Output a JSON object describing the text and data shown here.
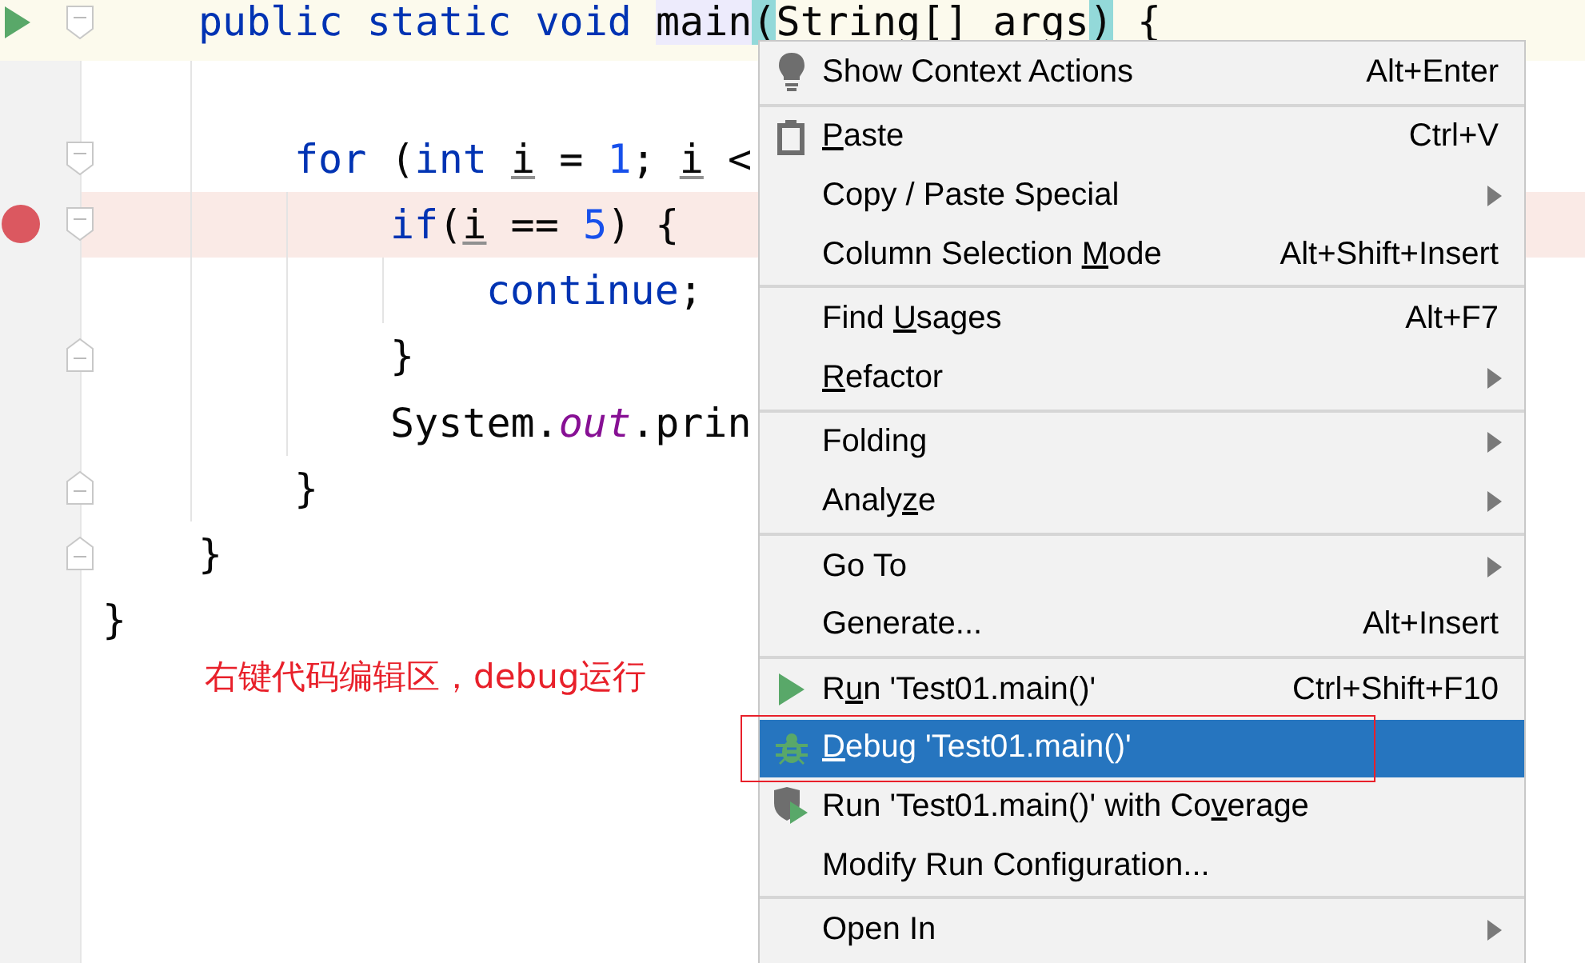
{
  "editor": {
    "lines": [
      {
        "children": [
          {
            "tokens": [
              {
                "text": "public static void ",
                "kind": "keyword"
              },
              {
                "text": "main",
                "kind": "plain",
                "usage_highlight": true
              },
              {
                "text": "(",
                "kind": "plain",
                "brace_match": true
              },
              {
                "text": "String[] args",
                "kind": "plain"
              },
              {
                "text": ")",
                "kind": "plain",
                "brace_match": true
              },
              {
                "text": " {",
                "kind": "plain"
              }
            ],
            "run_marker": true,
            "fold_start": true,
            "caret_line": true,
            "children": [
              {
                "kind": "blank"
              },
              {
                "tokens": [
                  {
                    "text": "for",
                    "kind": "keyword"
                  },
                  {
                    "text": " (",
                    "kind": "plain"
                  },
                  {
                    "text": "int ",
                    "kind": "keyword"
                  },
                  {
                    "text": "i",
                    "kind": "local"
                  },
                  {
                    "text": " = ",
                    "kind": "plain"
                  },
                  {
                    "text": "1",
                    "kind": "number"
                  },
                  {
                    "text": "; ",
                    "kind": "plain"
                  },
                  {
                    "text": "i",
                    "kind": "local"
                  },
                  {
                    "text": " <",
                    "kind": "plain"
                  }
                ],
                "fold_start": true,
                "children": [
                  {
                    "tokens": [
                      {
                        "text": "if",
                        "kind": "keyword"
                      },
                      {
                        "text": "(",
                        "kind": "plain"
                      },
                      {
                        "text": "i",
                        "kind": "local"
                      },
                      {
                        "text": " == ",
                        "kind": "plain"
                      },
                      {
                        "text": "5",
                        "kind": "number"
                      },
                      {
                        "text": ") {",
                        "kind": "plain"
                      }
                    ],
                    "breakpoint": true,
                    "fold_start": true,
                    "children": [
                      {
                        "tokens": [
                          {
                            "text": "continue",
                            "kind": "keyword"
                          },
                          {
                            "text": ";",
                            "kind": "plain"
                          }
                        ]
                      }
                    ]
                  },
                  {
                    "tokens": [
                      {
                        "text": "}",
                        "kind": "plain"
                      }
                    ],
                    "fold_end": true
                  },
                  {
                    "tokens": [
                      {
                        "text": "System.",
                        "kind": "plain"
                      },
                      {
                        "text": "out",
                        "kind": "static_field"
                      },
                      {
                        "text": ".prin",
                        "kind": "plain"
                      }
                    ]
                  }
                ]
              },
              {
                "tokens": [
                  {
                    "text": "}",
                    "kind": "plain"
                  }
                ],
                "fold_end": true
              }
            ]
          },
          {
            "tokens": [
              {
                "text": "}",
                "kind": "plain"
              }
            ],
            "fold_end": true
          }
        ]
      },
      {
        "tokens": [
          {
            "text": "}",
            "kind": "plain"
          }
        ]
      }
    ]
  },
  "annotation": {
    "text": "右键代码编辑区，debug运行"
  },
  "menu": {
    "sections": [
      {
        "items": [
          {
            "label": "Show Context Actions",
            "shortcut": "Alt+Enter",
            "kind": "bulb",
            "selected": false
          }
        ]
      },
      {
        "items": [
          {
            "label_parts": {
              "key": "P",
              "after": "aste"
            },
            "shortcut": "Ctrl+V",
            "kind": "clipboard",
            "selected": false
          },
          {
            "label": "Copy / Paste Special",
            "submenu": true,
            "selected": false
          },
          {
            "label_parts": {
              "before": "Column Selection ",
              "key": "M",
              "after": "ode"
            },
            "shortcut": "Alt+Shift+Insert",
            "selected": false
          }
        ]
      },
      {
        "items": [
          {
            "label_parts": {
              "before": "Find ",
              "key": "U",
              "after": "sages"
            },
            "shortcut": "Alt+F7",
            "selected": false
          },
          {
            "label_parts": {
              "key": "R",
              "after": "efactor"
            },
            "submenu": true,
            "selected": false
          }
        ]
      },
      {
        "items": [
          {
            "label": "Folding",
            "submenu": true,
            "selected": false
          },
          {
            "label_parts": {
              "before": "Analy",
              "key": "z",
              "after": "e"
            },
            "submenu": true,
            "selected": false
          }
        ]
      },
      {
        "items": [
          {
            "label": "Go To",
            "submenu": true,
            "selected": false
          },
          {
            "label": "Generate...",
            "shortcut": "Alt+Insert",
            "selected": false
          }
        ]
      },
      {
        "items": [
          {
            "label_parts": {
              "before": "R",
              "key": "u",
              "after": "n 'Test01.main()'"
            },
            "shortcut": "Ctrl+Shift+F10",
            "kind": "run",
            "selected": false
          },
          {
            "label_parts": {
              "key": "D",
              "after": "ebug 'Test01.main()'"
            },
            "kind": "debug",
            "selected": true,
            "annotated": true
          },
          {
            "label_parts": {
              "before": "Run 'Test01.main()' with Co",
              "key": "v",
              "after": "erage"
            },
            "kind": "coverage",
            "selected": false
          },
          {
            "label": "Modify Run Configuration...",
            "selected": false
          }
        ]
      },
      {
        "items": [
          {
            "label": "Open In",
            "submenu": true,
            "selected": false
          }
        ]
      }
    ]
  }
}
